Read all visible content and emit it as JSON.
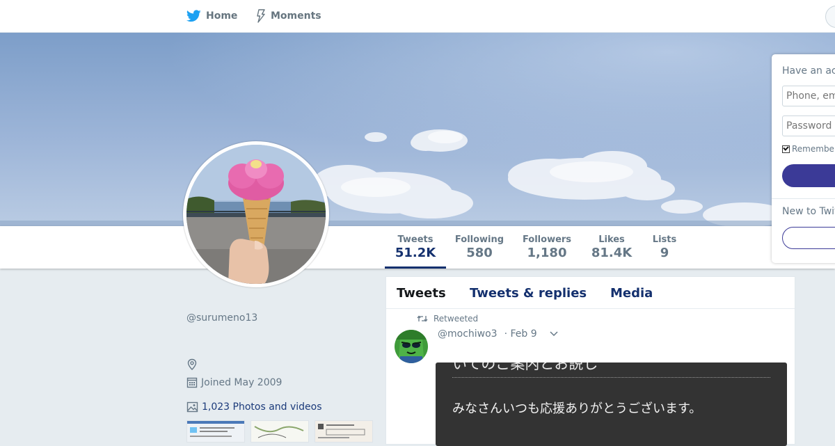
{
  "nav": {
    "home_label": "Home",
    "moments_label": "Moments"
  },
  "profile": {
    "screen_name": "@surumeno13",
    "joined": "Joined May 2009",
    "photos_link": "1,023 Photos and videos"
  },
  "stats": [
    {
      "label": "Tweets",
      "value": "51.2K",
      "active": true
    },
    {
      "label": "Following",
      "value": "580"
    },
    {
      "label": "Followers",
      "value": "1,180"
    },
    {
      "label": "Likes",
      "value": "81.4K"
    },
    {
      "label": "Lists",
      "value": "9"
    }
  ],
  "timeline": {
    "tabs": [
      "Tweets",
      "Tweets & replies",
      "Media"
    ],
    "tweet": {
      "context": "Retweeted",
      "handle": "@mochiwo3",
      "date": "· Feb 9",
      "card_top": "いてのご案内とお説し",
      "card_text": "みなさんいつも応援ありがとうございます。"
    }
  },
  "login": {
    "title": "Have an ac",
    "phone_placeholder": "Phone, em",
    "password_placeholder": "Password",
    "remember": "Remember",
    "new_to": "New to Twit"
  },
  "colors": {
    "accent": "#14306e",
    "button": "#3b3a97",
    "page_bg": "#e6ecf0",
    "twitter_blue": "#1da1f2"
  },
  "icons": {
    "home": "twitter-bird-icon",
    "moments": "lightning-icon",
    "location": "location-pin-icon",
    "calendar": "calendar-icon",
    "photos": "image-icon",
    "retweet": "retweet-icon",
    "caret": "chevron-down-icon"
  }
}
